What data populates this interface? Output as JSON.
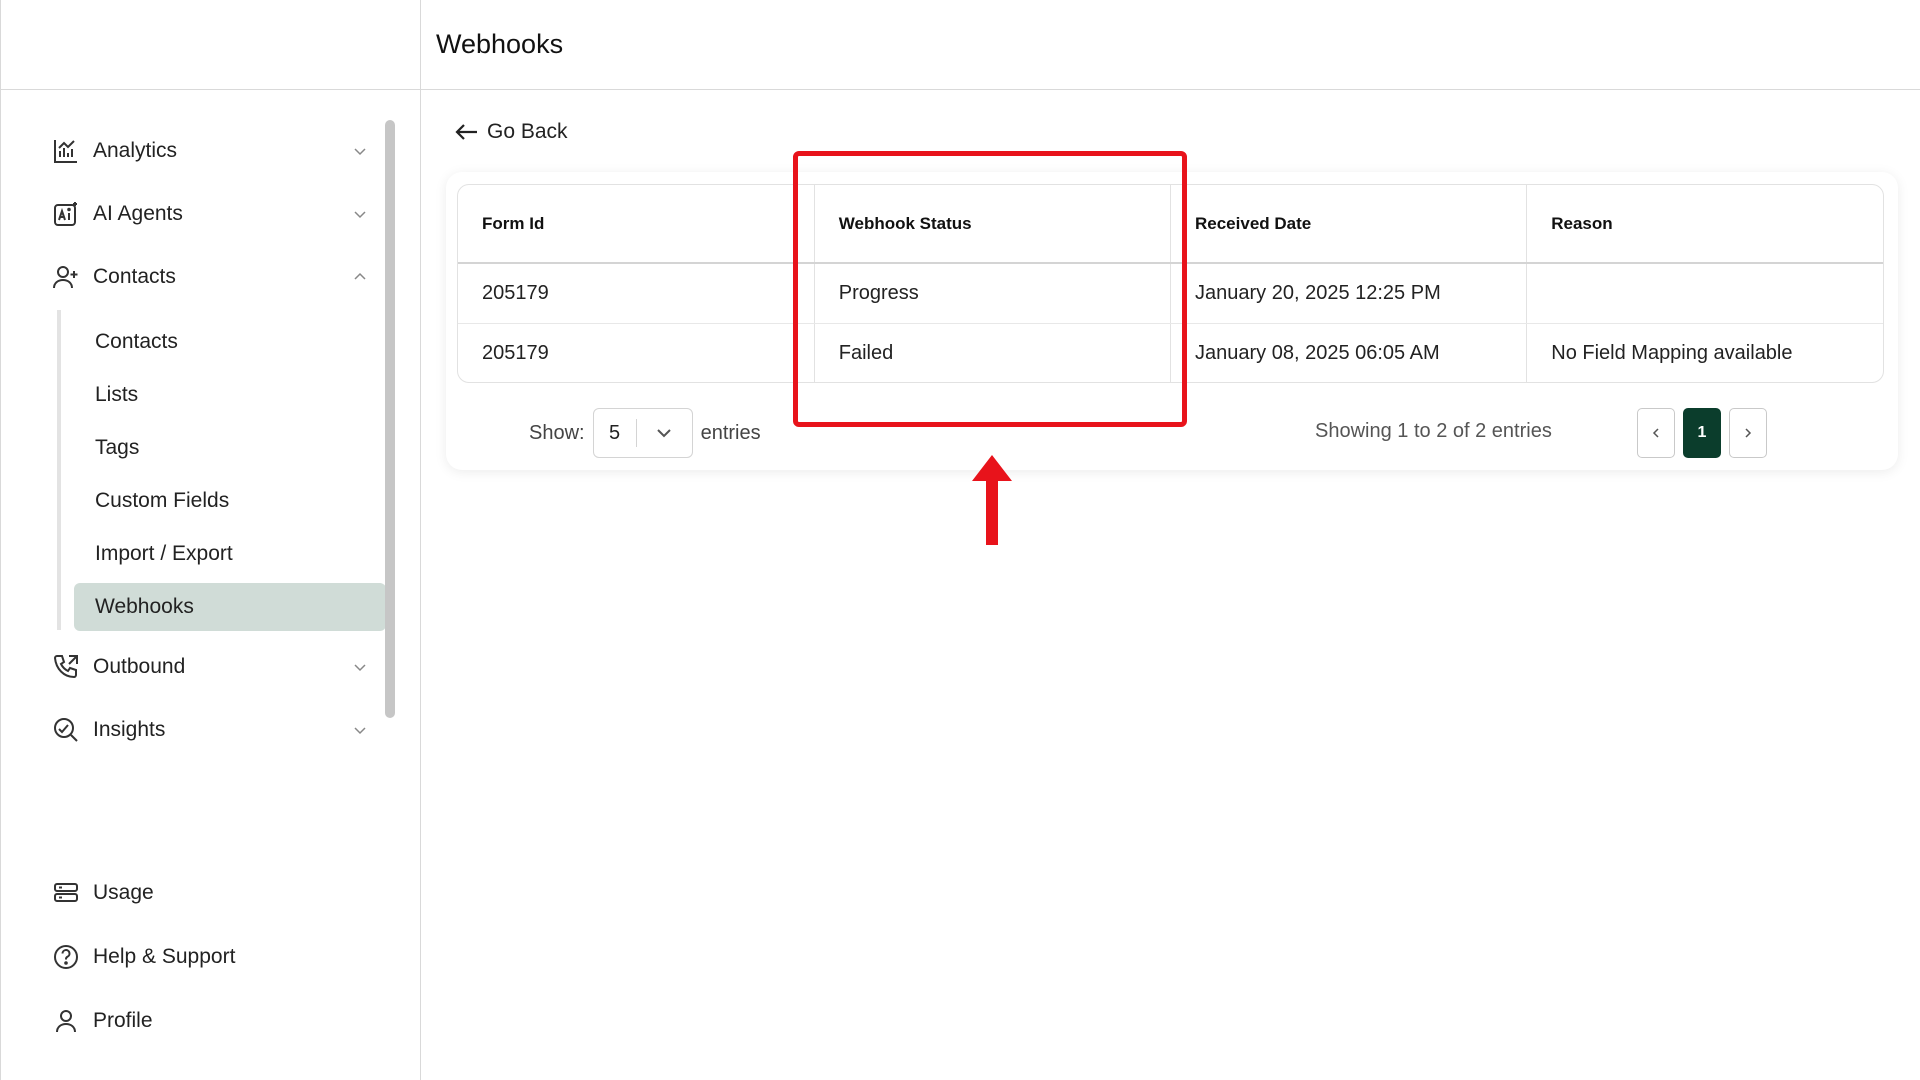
{
  "header": {
    "title": "Webhooks"
  },
  "sidebar": {
    "items": [
      {
        "label": "Analytics",
        "icon": "analytics-chart-icon",
        "expanded": false
      },
      {
        "label": "AI Agents",
        "icon": "ai-agents-icon",
        "expanded": false
      },
      {
        "label": "Contacts",
        "icon": "user-plus-icon",
        "expanded": true
      },
      {
        "label": "Outbound",
        "icon": "phone-outgoing-icon",
        "expanded": false
      },
      {
        "label": "Insights",
        "icon": "insights-icon",
        "expanded": false
      }
    ],
    "contacts_submenu": [
      {
        "label": "Contacts"
      },
      {
        "label": "Lists"
      },
      {
        "label": "Tags"
      },
      {
        "label": "Custom Fields"
      },
      {
        "label": "Import / Export"
      },
      {
        "label": "Webhooks",
        "active": true
      }
    ],
    "bottom_items": [
      {
        "label": "Usage",
        "icon": "usage-icon"
      },
      {
        "label": "Help & Support",
        "icon": "help-circle-icon"
      },
      {
        "label": "Profile",
        "icon": "user-icon"
      }
    ]
  },
  "main": {
    "go_back_label": "Go Back",
    "table": {
      "columns": [
        "Form Id",
        "Webhook Status",
        "Received Date",
        "Reason"
      ],
      "rows": [
        {
          "form_id": "205179",
          "status": "Progress",
          "received_date": "January 20, 2025 12:25 PM",
          "reason": ""
        },
        {
          "form_id": "205179",
          "status": "Failed",
          "received_date": "January 08, 2025 06:05 AM",
          "reason": "No Field Mapping available"
        }
      ]
    },
    "pagination": {
      "show_label": "Show:",
      "page_size": "5",
      "entries_label": "entries",
      "summary": "Showing 1 to 2 of 2 entries",
      "current_page": "1"
    }
  },
  "colors": {
    "active_nav_bg": "#d0dcd7",
    "pager_active": "#0b3d2c",
    "annotation": "#e8131b"
  }
}
